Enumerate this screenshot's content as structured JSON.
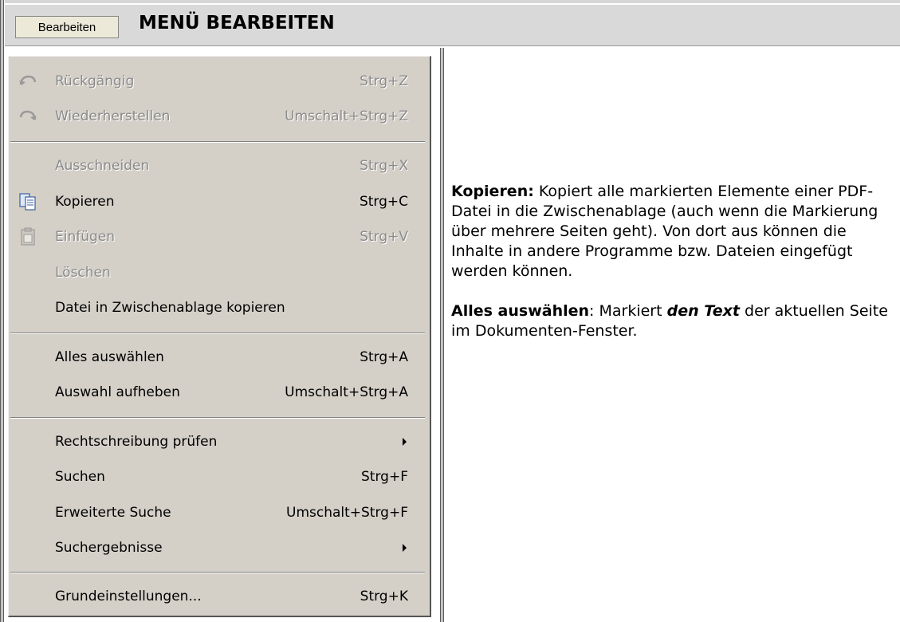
{
  "header": {
    "button_label": "Bearbeiten",
    "title": "MENÜ BEARBEITEN"
  },
  "menu": {
    "items": [
      {
        "label": "Rückgängig",
        "shortcut": "Strg+Z",
        "enabled": false,
        "icon": "undo-icon"
      },
      {
        "label": "Wiederherstellen",
        "shortcut": "Umschalt+Strg+Z",
        "enabled": false,
        "icon": "redo-icon"
      },
      {
        "label": "Ausschneiden",
        "shortcut": "Strg+X",
        "enabled": false
      },
      {
        "label": "Kopieren",
        "shortcut": "Strg+C",
        "enabled": true,
        "icon": "copy-icon"
      },
      {
        "label": "Einfügen",
        "shortcut": "Strg+V",
        "enabled": false,
        "icon": "paste-icon"
      },
      {
        "label": "Löschen",
        "shortcut": "",
        "enabled": false
      },
      {
        "label": "Datei in Zwischenablage kopieren",
        "shortcut": "",
        "enabled": true
      },
      {
        "label": "Alles auswählen",
        "shortcut": "Strg+A",
        "enabled": true
      },
      {
        "label": "Auswahl aufheben",
        "shortcut": "Umschalt+Strg+A",
        "enabled": true
      },
      {
        "label": "Rechtschreibung prüfen",
        "shortcut": "",
        "enabled": true,
        "submenu": true
      },
      {
        "label": "Suchen",
        "shortcut": "Strg+F",
        "enabled": true
      },
      {
        "label": "Erweiterte Suche",
        "shortcut": "Umschalt+Strg+F",
        "enabled": true
      },
      {
        "label": "Suchergebnisse",
        "shortcut": "",
        "enabled": true,
        "submenu": true
      },
      {
        "label": "Grundeinstellungen...",
        "shortcut": "Strg+K",
        "enabled": true
      }
    ]
  },
  "description": {
    "kopieren_term": "Kopieren:",
    "kopieren_text": " Kopiert alle markierten Elemente einer PDF-Datei in die Zwischenablage (auch wenn die Markierung über mehrere Seiten geht). Von dort aus können die Inhalte in andere Programme bzw. Dateien eingefügt werden können.",
    "alles_term": "Alles auswählen",
    "alles_text_1": ": Markiert ",
    "alles_emphasis": "den Text",
    "alles_text_2": " der aktuellen Seite im Dokumenten-Fenster."
  }
}
